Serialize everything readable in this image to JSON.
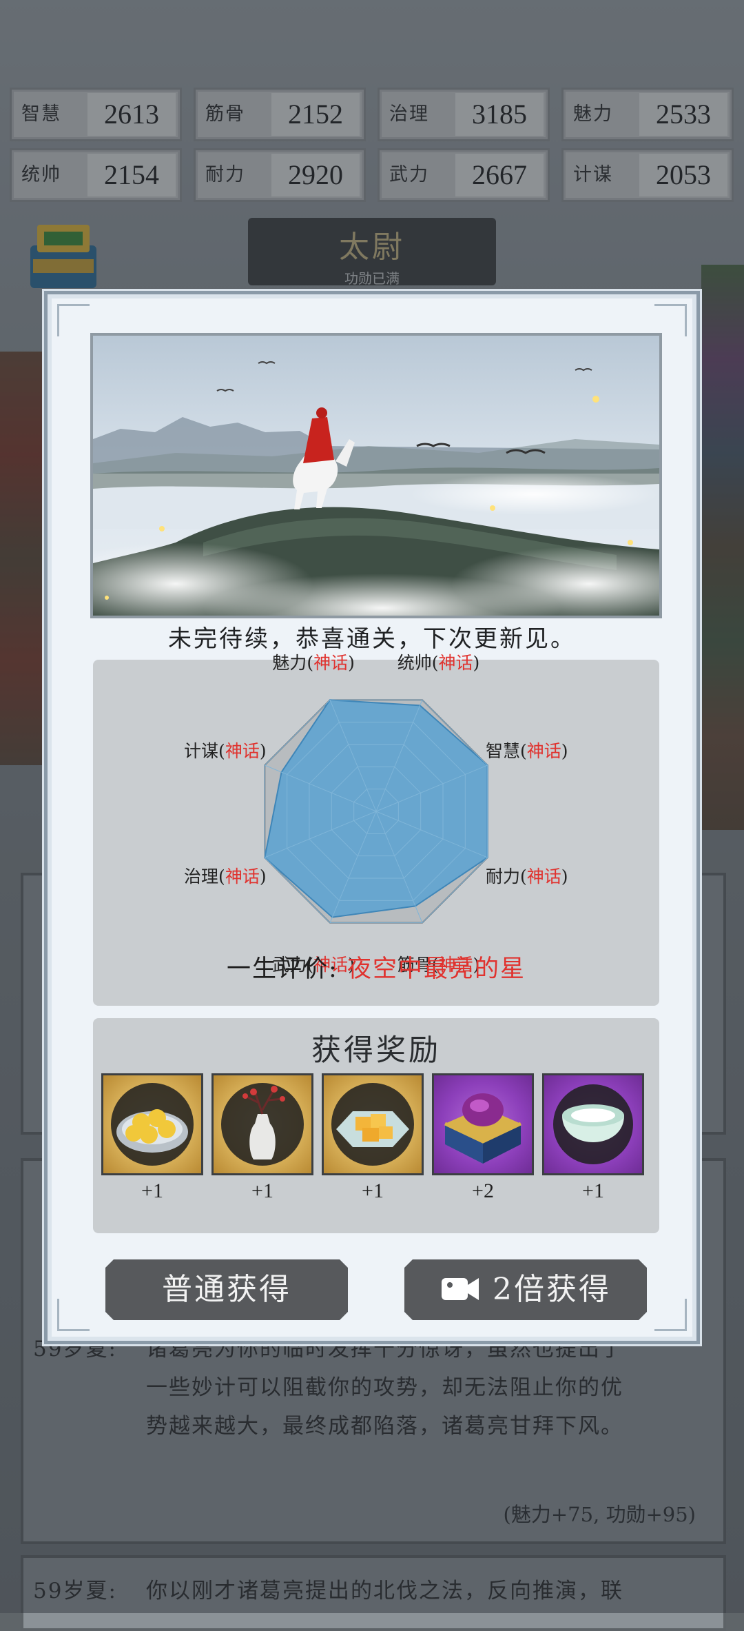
{
  "stats": [
    {
      "label": "智慧",
      "value": "2613"
    },
    {
      "label": "筋骨",
      "value": "2152"
    },
    {
      "label": "治理",
      "value": "3185"
    },
    {
      "label": "魅力",
      "value": "2533"
    },
    {
      "label": "统帅",
      "value": "2154"
    },
    {
      "label": "耐力",
      "value": "2920"
    },
    {
      "label": "武力",
      "value": "2667"
    },
    {
      "label": "计谋",
      "value": "2053"
    }
  ],
  "rank": {
    "title": "太尉",
    "subtitle": "功勋已满"
  },
  "log": {
    "entry1": {
      "age": "59岁夏:",
      "line1": "诸葛亮为你的临时发挥十分惊讶，虽然也提出了",
      "line2": "一些妙计可以阻截你的攻势，却无法阻止你的优",
      "line3": "势越来越大，最终成都陷落，诸葛亮甘拜下风。",
      "note": "(魅力+75, 功勋+95)"
    },
    "entry2": {
      "age": "59岁夏:",
      "line1": "你以刚才诸葛亮提出的北伐之法，反向推演，联"
    }
  },
  "modal": {
    "ending_text": "未完待续，恭喜通关，下次更新见。",
    "radar": {
      "grade": "神话",
      "attributes": [
        {
          "name": "统帅",
          "grade": "神话",
          "value": 0.95
        },
        {
          "name": "智慧",
          "grade": "神话",
          "value": 1.0
        },
        {
          "name": "耐力",
          "grade": "神话",
          "value": 1.0
        },
        {
          "name": "筋骨",
          "grade": "神话",
          "value": 0.85
        },
        {
          "name": "武力",
          "grade": "神话",
          "value": 0.95
        },
        {
          "name": "治理",
          "grade": "神话",
          "value": 1.0
        },
        {
          "name": "计谋",
          "grade": "神话",
          "value": 0.85
        },
        {
          "name": "魅力",
          "grade": "神话",
          "value": 1.0
        }
      ],
      "eval_label": "一生评价:",
      "eval_value": "夜空中最亮的星"
    },
    "rewards": {
      "title": "获得奖励",
      "items": [
        {
          "icon": "pastry-plate-icon",
          "count": "+1",
          "rarity": "gold"
        },
        {
          "icon": "plum-vase-icon",
          "count": "+1",
          "rarity": "gold"
        },
        {
          "icon": "jelly-cake-plate-icon",
          "count": "+1",
          "rarity": "gold"
        },
        {
          "icon": "treasure-chest-icon",
          "count": "+2",
          "rarity": "purple"
        },
        {
          "icon": "milk-bowl-icon",
          "count": "+1",
          "rarity": "purple"
        }
      ]
    },
    "buttons": {
      "normal": "普通获得",
      "double": "2倍获得"
    }
  },
  "colors": {
    "accent_red": "#e0322e",
    "radar_fill": "#5fa3d0",
    "button": "#57595c"
  }
}
